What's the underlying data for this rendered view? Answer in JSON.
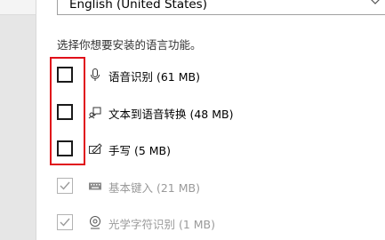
{
  "language_select": {
    "value": "English (United States)",
    "chevron_icon": "chevron-down-icon"
  },
  "instruction": "选择你想要安装的语言功能。",
  "features": [
    {
      "label": "语音识别 (61 MB)",
      "icon": "microphone-icon",
      "checked": false,
      "enabled": true
    },
    {
      "label": "文本到语音转换 (48 MB)",
      "icon": "speech-bubble-icon",
      "checked": false,
      "enabled": true
    },
    {
      "label": "手写 (5 MB)",
      "icon": "pen-tablet-icon",
      "checked": false,
      "enabled": true
    },
    {
      "label": "基本键入 (21 MB)",
      "icon": "keyboard-icon",
      "checked": true,
      "enabled": false
    },
    {
      "label": "光学字符识别 (1 MB)",
      "icon": "ocr-eye-icon",
      "checked": true,
      "enabled": false
    }
  ],
  "colors": {
    "highlight": "#e0101a",
    "checkbox_border": "#1a1a1a",
    "disabled_text": "#9a9a9a"
  }
}
